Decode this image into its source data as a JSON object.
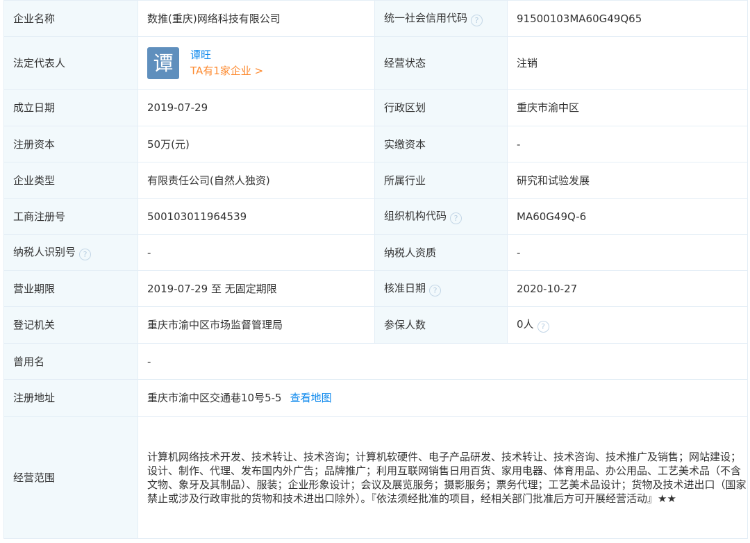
{
  "rows": {
    "company_name": {
      "label": "企业名称",
      "value": "数推(重庆)网络科技有限公司"
    },
    "credit_code": {
      "label": "统一社会信用代码",
      "value": "91500103MA60G49Q65"
    },
    "legal_rep": {
      "label": "法定代表人",
      "avatar_char": "谭",
      "name": "谭旺",
      "more": "TA有1家企业 >"
    },
    "status": {
      "label": "经营状态",
      "value": "注销"
    },
    "founded": {
      "label": "成立日期",
      "value": "2019-07-29"
    },
    "region": {
      "label": "行政区划",
      "value": "重庆市渝中区"
    },
    "reg_capital": {
      "label": "注册资本",
      "value": "50万(元)"
    },
    "paid_capital": {
      "label": "实缴资本",
      "value": "-"
    },
    "company_type": {
      "label": "企业类型",
      "value": "有限责任公司(自然人独资)"
    },
    "industry": {
      "label": "所属行业",
      "value": "研究和试验发展"
    },
    "reg_number": {
      "label": "工商注册号",
      "value": "500103011964539"
    },
    "org_code": {
      "label": "组织机构代码",
      "value": "MA60G49Q-6"
    },
    "taxpayer_id": {
      "label": "纳税人识别号",
      "value": "-"
    },
    "taxpayer_quality": {
      "label": "纳税人资质",
      "value": "-"
    },
    "business_term": {
      "label": "营业期限",
      "value": "2019-07-29 至 无固定期限"
    },
    "approval_date": {
      "label": "核准日期",
      "value": "2020-10-27"
    },
    "reg_authority": {
      "label": "登记机关",
      "value": "重庆市渝中区市场监督管理局"
    },
    "insured": {
      "label": "参保人数",
      "value": "0人"
    },
    "former_name": {
      "label": "曾用名",
      "value": "-"
    },
    "address": {
      "label": "注册地址",
      "value": "重庆市渝中区交通巷10号5-5",
      "link": "查看地图"
    },
    "scope": {
      "label": "经营范围",
      "value": "计算机网络技术开发、技术转让、技术咨询；计算机软硬件、电子产品研发、技术转让、技术咨询、技术推广及销售；网站建设；设计、制作、代理、发布国内外广告；品牌推广；利用互联网销售日用百货、家用电器、体育用品、办公用品、工艺美术品（不含文物、象牙及其制品）、服装；企业形象设计；会议及展览服务；摄影服务；票务代理；工艺美术品设计；货物及技术进出口（国家禁止或涉及行政审批的货物和技术进出口除外）。『依法须经批准的项目，经相关部门批准后方可开展经营活动』★★"
    }
  },
  "help_glyph": "?",
  "colors": {
    "label_bg": "#f2f9fc",
    "border": "#e4eef6",
    "link": "#128bed",
    "orange": "#fd8a2f",
    "avatar_bg": "#5f8fbd"
  }
}
